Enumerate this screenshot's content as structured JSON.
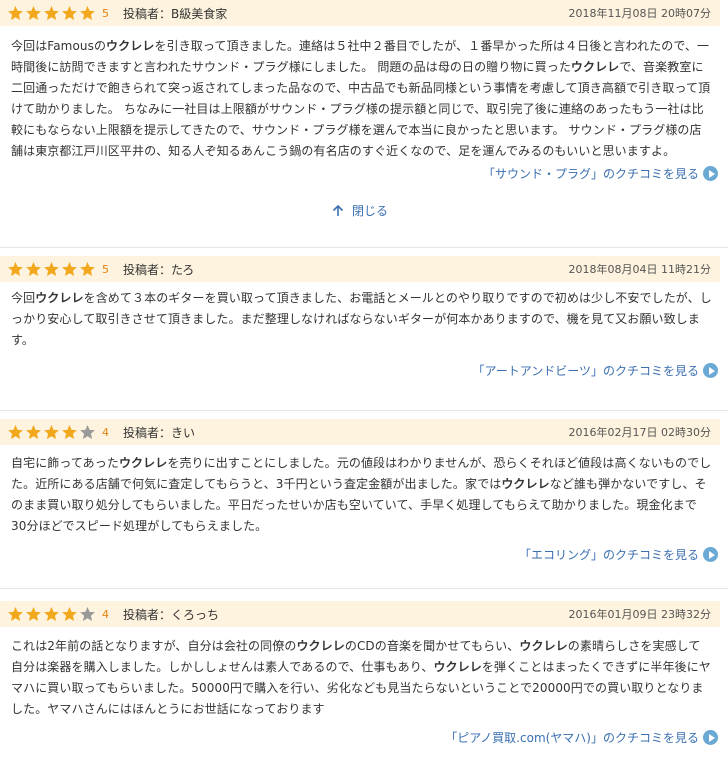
{
  "colors": {
    "header_bg": "#fdf3de",
    "star_on": "#f2a81d",
    "star_off": "#999999",
    "link": "#3a6fb0",
    "play": "#6aa9d3"
  },
  "reviews": [
    {
      "rating": 5,
      "rating_label": "5",
      "poster": "投稿者：B級美食家",
      "date": "2018年11月08日 20時07分",
      "lines": [
        [
          "今回はFamousの",
          {
            "b": "ウクレレ"
          },
          "を引き取って頂きました。連絡は５社中２番目でしたが、１番早かった所は４日後と言われたので、一"
        ],
        [
          "時間後に訪問できますと言われたサウンド・プラグ様にしました。 問題の品は母の日の贈り物に買った",
          {
            "b": "ウクレレ"
          },
          "で、音楽教室に"
        ],
        [
          "二回通っただけで飽きられて突っ返されてしまった品なので、中古品でも新品同様という事情を考慮して頂き高額で引き取って頂"
        ],
        [
          "けて助かりました。 ちなみに一社目は上限額がサウンド・プラグ様の提示額と同じで、取引完了後に連絡のあったもう一社は比"
        ],
        [
          "較にもならない上限額を提示してきたので、サウンド・プラグ様を選んで本当に良かったと思います。 サウンド・プラグ様の店"
        ],
        [
          "舗は東京都江戸川区平井の、知る人ぞ知るあんこう鍋の有名店のすぐ近くなので、足を運んでみるのもいいと思いますよ。"
        ]
      ],
      "link": "「サウンド・プラグ」のクチコミを見る"
    },
    {
      "rating": 5,
      "rating_label": "5",
      "poster": "投稿者：たろ",
      "date": "2018年08月04日 11時21分",
      "lines": [
        [
          "今回",
          {
            "b": "ウクレレ"
          },
          "を含めて３本のギターを買い取って頂きました、お電話とメールとのやり取りですので初めは少し不安でしたが、し"
        ],
        [
          "っかり安心して取引きさせて頂きました。まだ整理しなければならないギターが何本かありますので、機を見て又お願い致しま"
        ],
        [
          "す。"
        ]
      ],
      "link": "「アートアンドビーツ」のクチコミを見る"
    },
    {
      "rating": 4,
      "rating_label": "4",
      "poster": "投稿者：きい",
      "date": "2016年02月17日 02時30分",
      "lines": [
        [
          "自宅に飾ってあった",
          {
            "b": "ウクレレ"
          },
          "を売りに出すことにしました。元の値段はわかりませんが、恐らくそれほど値段は高くないものでし"
        ],
        [
          "た。近所にある店舗で何気に査定してもらうと、3千円という査定金額が出ました。家では",
          {
            "b": "ウクレレ"
          },
          "など誰も弾かないですし、そ"
        ],
        [
          "のまま買い取り処分してもらいました。平日だったせいか店も空いていて、手早く処理してもらえて助かりました。現金化まで"
        ],
        [
          "30分ほどでスピード処理がしてもらえました。"
        ]
      ],
      "link": "「エコリング」のクチコミを見る"
    },
    {
      "rating": 4,
      "rating_label": "4",
      "poster": "投稿者：くろっち",
      "date": "2016年01月09日 23時32分",
      "lines": [
        [
          "これは2年前の話となりますが、自分は会社の同僚の",
          {
            "b": "ウクレレ"
          },
          "のCDの音楽を聞かせてもらい、",
          {
            "b": "ウクレレ"
          },
          "の素晴らしさを実感して"
        ],
        [
          "自分は楽器を購入しました。しかししょせんは素人であるので、仕事もあり、",
          {
            "b": "ウクレレ"
          },
          "を弾くことはまったくできずに半年後にヤ"
        ],
        [
          "マハに買い取ってもらいました。50000円で購入を行い、劣化なども見当たらないということで20000円での買い取りとなりま"
        ],
        [
          "した。ヤマハさんにはほんとうにお世話になっております"
        ]
      ],
      "link": "「ピアノ買取.com(ヤマハ)」のクチコミを見る"
    }
  ],
  "close_label": "閉じる"
}
